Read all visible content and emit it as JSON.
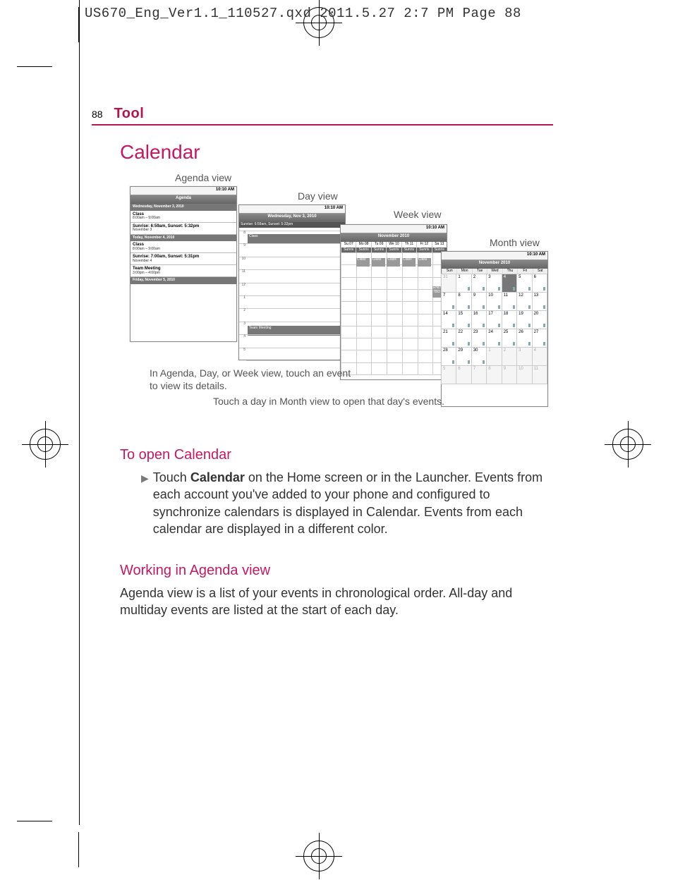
{
  "slug": "US670_Eng_Ver1.1_110527.qxd  2011.5.27  2:7 PM  Page 88",
  "runhead": {
    "page": "88",
    "section": "Tool"
  },
  "title": "Calendar",
  "labels": {
    "agenda": "Agenda view",
    "day": "Day view",
    "week": "Week view",
    "month": "Month view"
  },
  "captions": {
    "touch_event": "In Agenda, Day, or Week view, touch an event to view its details.",
    "touch_day": "Touch a day in Month view to open that day's events."
  },
  "status_time": "10:10 AM",
  "agenda": {
    "title": "Agenda",
    "items": [
      {
        "hdr": "Wednesday, November 3, 2010"
      },
      {
        "t": "Class",
        "s": "8:00am – 9:00am"
      },
      {
        "t": "Sunrise: 6:59am, Sunset: 5:32pm",
        "s": "November 3"
      },
      {
        "hdr": "Today, November 4, 2010"
      },
      {
        "t": "Class",
        "s": "8:00am – 9:00am"
      },
      {
        "t": "Sunrise: 7:00am, Sunset: 5:31pm",
        "s": "November 4"
      },
      {
        "t": "Team Meeting",
        "s": "3:00pm – 4:00pm"
      },
      {
        "hdr": "Friday, November 5, 2010"
      }
    ]
  },
  "day": {
    "title": "Wednesday, Nov 3, 2010",
    "allday": "Sunrise: 6:59am, Sunset: 5:32pm",
    "events": [
      {
        "label": "Class"
      },
      {
        "label": "Team Meeting"
      }
    ],
    "hours": [
      "8",
      "9",
      "10",
      "11",
      "12",
      "1",
      "2",
      "3",
      "4",
      "5"
    ]
  },
  "week": {
    "title": "November 2010",
    "days": [
      "Su 07",
      "Mo 08",
      "Tu 09",
      "We 10",
      "Th 11",
      "Fr 12",
      "Sa 13"
    ],
    "allday_cell": "Sunris",
    "event_cell": "Class",
    "end_cell": "END TBD"
  },
  "month": {
    "title": "November 2010",
    "dow": [
      "Sun",
      "Mon",
      "Tue",
      "Wed",
      "Thu",
      "Fri",
      "Sat"
    ],
    "days": [
      {
        "n": "31",
        "dim": true
      },
      {
        "n": "1"
      },
      {
        "n": "2"
      },
      {
        "n": "3"
      },
      {
        "n": "4",
        "today": true
      },
      {
        "n": "5"
      },
      {
        "n": "6"
      },
      {
        "n": "7"
      },
      {
        "n": "8"
      },
      {
        "n": "9"
      },
      {
        "n": "10"
      },
      {
        "n": "11"
      },
      {
        "n": "12"
      },
      {
        "n": "13"
      },
      {
        "n": "14"
      },
      {
        "n": "15"
      },
      {
        "n": "16"
      },
      {
        "n": "17"
      },
      {
        "n": "18"
      },
      {
        "n": "19"
      },
      {
        "n": "20"
      },
      {
        "n": "21"
      },
      {
        "n": "22"
      },
      {
        "n": "23"
      },
      {
        "n": "24"
      },
      {
        "n": "25"
      },
      {
        "n": "26"
      },
      {
        "n": "27"
      },
      {
        "n": "28"
      },
      {
        "n": "29"
      },
      {
        "n": "30"
      },
      {
        "n": "1",
        "dim": true
      },
      {
        "n": "2",
        "dim": true
      },
      {
        "n": "3",
        "dim": true
      },
      {
        "n": "4",
        "dim": true
      },
      {
        "n": "5",
        "dim": true
      },
      {
        "n": "6",
        "dim": true
      },
      {
        "n": "7",
        "dim": true
      },
      {
        "n": "8",
        "dim": true
      },
      {
        "n": "9",
        "dim": true
      },
      {
        "n": "10",
        "dim": true
      },
      {
        "n": "11",
        "dim": true
      }
    ]
  },
  "sections": {
    "open_h": "To open Calendar",
    "open_prefix": "Touch ",
    "open_bold": "Calendar",
    "open_rest": " on the Home screen or in the Launcher. Events from each account you've added to your phone and configured to synchronize calendars is displayed in Calendar. Events from each calendar are displayed in a different color.",
    "agenda_h": "Working in Agenda view",
    "agenda_p": "Agenda view is a list of your events in chronological order. All-day and multiday events are listed at the start of each day."
  }
}
